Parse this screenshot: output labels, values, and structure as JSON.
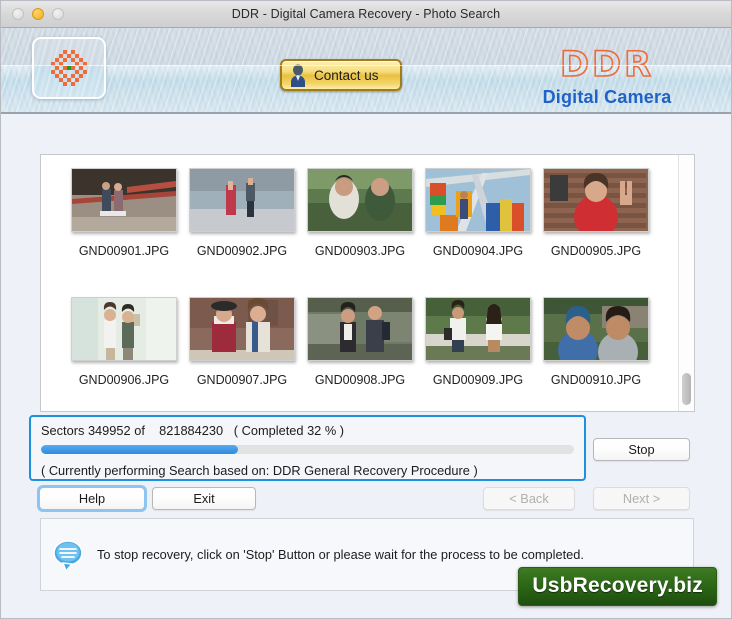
{
  "window": {
    "title": "DDR - Digital Camera Recovery - Photo Search",
    "traffic_lights": [
      "close",
      "minimize",
      "maximize"
    ]
  },
  "header": {
    "app_icon_name": "checkered-flower-icon",
    "contact_button_label": "Contact us",
    "logo_title": "DDR",
    "logo_subtitle": "Digital Camera",
    "logo_color": "#f06a38",
    "logo_subtitle_color": "#1f63c8"
  },
  "thumbnails": {
    "rows": [
      [
        {
          "file": "GND00901.JPG",
          "scene": "couple-sitting-on-steps"
        },
        {
          "file": "GND00902.JPG",
          "scene": "two-women-by-lake"
        },
        {
          "file": "GND00903.JPG",
          "scene": "couple-outdoors-green"
        },
        {
          "file": "GND00904.JPG",
          "scene": "amusement-park-ride"
        },
        {
          "file": "GND00905.JPG",
          "scene": "woman-red-top-brick-wall"
        }
      ],
      [
        {
          "file": "GND00906.JPG",
          "scene": "two-women-white-wall"
        },
        {
          "file": "GND00907.JPG",
          "scene": "two-women-posing-hat"
        },
        {
          "file": "GND00908.JPG",
          "scene": "couple-street-backpack"
        },
        {
          "file": "GND00909.JPG",
          "scene": "two-women-on-bridge"
        },
        {
          "file": "GND00910.JPG",
          "scene": "couple-smiling-outdoors"
        }
      ]
    ]
  },
  "progress": {
    "sectors_prefix": "Sectors",
    "sectors_done": "349952",
    "sectors_of": "of",
    "sectors_total": "821884230",
    "completed_text": "( Completed 32 % )",
    "sector_line": "Sectors 349952 of    821884230   ( Completed 32 % )",
    "percent": 32,
    "bar_fill_percent": 37,
    "status_line": "( Currently performing Search based on: DDR General Recovery Procedure )",
    "border_color": "#1e90e0",
    "fill_color": "#2d8ce0"
  },
  "buttons": {
    "stop": {
      "label": "Stop",
      "disabled": false,
      "focused": false
    },
    "help": {
      "label": "Help",
      "disabled": false,
      "focused": true
    },
    "exit": {
      "label": "Exit",
      "disabled": false,
      "focused": false
    },
    "back": {
      "label": "< Back",
      "disabled": true,
      "focused": false
    },
    "next": {
      "label": "Next >",
      "disabled": true,
      "focused": false
    }
  },
  "info": {
    "icon_name": "speech-bubble-info-icon",
    "message": "To stop recovery, click on 'Stop' Button or please wait for the process to be completed."
  },
  "watermark": {
    "text": "UsbRecovery.biz",
    "color": "#2e6a18"
  }
}
